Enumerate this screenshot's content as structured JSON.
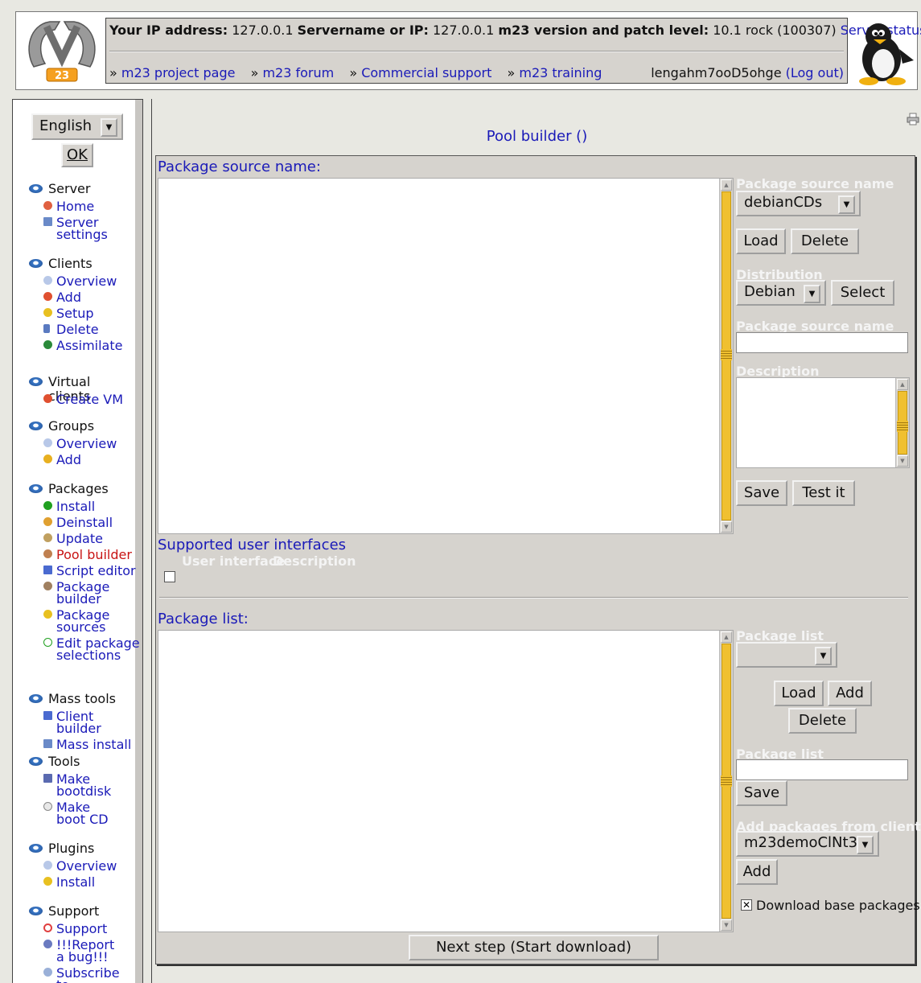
{
  "header": {
    "ip_label": "Your IP address:",
    "ip_value": "127.0.0.1",
    "server_label": "Servername or IP:",
    "server_value": "127.0.0.1",
    "version_label": "m23 version and patch level:",
    "version_value": "10.1 rock (100307)",
    "server_status": "Server status",
    "links": [
      "m23 project page",
      "m23 forum",
      "Commercial support",
      "m23 training"
    ],
    "username": "lengahm7ooD5ohge",
    "logout": "(Log out)"
  },
  "sidebar": {
    "language": "English",
    "ok_label": "OK",
    "groups": [
      {
        "title": "Server",
        "items": [
          "Home",
          "Server settings"
        ]
      },
      {
        "title": "Clients",
        "items": [
          "Overview",
          "Add",
          "Setup",
          "Delete",
          "Assimilate"
        ]
      },
      {
        "title": "Virtual clients",
        "items": [
          "Create VM"
        ]
      },
      {
        "title": "Groups",
        "items": [
          "Overview",
          "Add"
        ]
      },
      {
        "title": "Packages",
        "items": [
          "Install",
          "Deinstall",
          "Update",
          "Pool builder",
          "Script editor",
          "Package builder",
          "Package sources",
          "Edit package selections"
        ]
      },
      {
        "title": "Mass tools",
        "items": [
          "Client builder",
          "Mass install"
        ]
      },
      {
        "title": "Tools",
        "items": [
          "Make bootdisk",
          "Make boot CD"
        ]
      },
      {
        "title": "Plugins",
        "items": [
          "Overview",
          "Install"
        ]
      },
      {
        "title": "Support",
        "items": [
          "Support",
          "!!!Report a bug!!!",
          "Subscribe to"
        ]
      }
    ],
    "active_item": "Pool builder"
  },
  "main": {
    "title": "Pool builder ()",
    "source_section": {
      "label": "Package source name:",
      "right": {
        "source_name_label": "Package source name",
        "source_name_value": "debianCDs",
        "load": "Load",
        "delete": "Delete",
        "distribution_label": "Distribution",
        "distribution_value": "Debian",
        "select": "Select",
        "source_name_input_label": "Package source name",
        "source_name_input_value": "",
        "description_label": "Description",
        "save": "Save",
        "test": "Test it"
      }
    },
    "ui_section": {
      "label": "Supported user interfaces",
      "col_ui": "User interface",
      "col_desc": "Description"
    },
    "package_section": {
      "label": "Package list:",
      "right": {
        "list_label": "Package list",
        "list_value": "",
        "load": "Load",
        "add": "Add",
        "delete": "Delete",
        "list_input_label": "Package list",
        "list_input_value": "",
        "save": "Save",
        "client_label": "Add packages from client",
        "client_value": "m23demoClNt3",
        "client_add": "Add",
        "download_base_label": "Download base packages",
        "download_base_checked": true
      }
    },
    "next_step": "Next step (Start download)"
  },
  "colors": {
    "link": "#1a1ab8",
    "active": "#c81414",
    "panel": "#d6d3ce",
    "scrollbar": "#f0c030"
  }
}
